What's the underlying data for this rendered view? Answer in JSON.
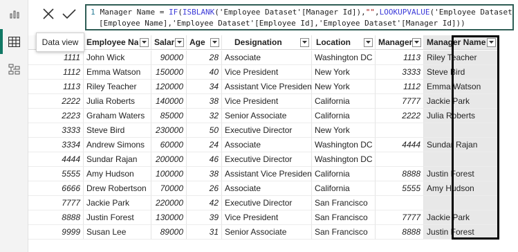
{
  "rail": {
    "icons": [
      "report-view-icon",
      "data-view-icon",
      "model-view-icon"
    ],
    "tooltip": "Data view",
    "accent": "#117865"
  },
  "formula": {
    "line_number": "1",
    "parts": {
      "p1": "Manager Name = ",
      "p2": "IF",
      "p3": "(",
      "p4": "ISBLANK",
      "p5": "('Employee Dataset'[Manager Id]),",
      "p6": "\"\"",
      "p7": ",",
      "p8": "LOOKUPVALUE",
      "p9": "('Employee Dataset'",
      "p10": "[Employee Name],'Employee Dataset'[Employee Id],'Employee Dataset'[Manager Id]))"
    }
  },
  "table": {
    "headers": [
      "",
      "Employee Na",
      "Salar",
      "Age",
      "Designation",
      "Location",
      "Manager",
      "Manager Name"
    ],
    "rows": [
      [
        "1111",
        "John Wick",
        "90000",
        "28",
        "Associate",
        "Washington DC",
        "1113",
        "Riley Teacher"
      ],
      [
        "1112",
        "Emma Watson",
        "150000",
        "40",
        "Vice President",
        "New York",
        "3333",
        "Steve Bird"
      ],
      [
        "1113",
        "Riley Teacher",
        "120000",
        "34",
        "Assistant Vice President",
        "New York",
        "1112",
        "Emma Watson"
      ],
      [
        "2222",
        "Julia Roberts",
        "140000",
        "38",
        "Vice President",
        "California",
        "7777",
        "Jackie Park"
      ],
      [
        "2223",
        "Graham Waters",
        "85000",
        "32",
        "Senior Associate",
        "California",
        "2222",
        "Julia Roberts"
      ],
      [
        "3333",
        "Steve Bird",
        "230000",
        "50",
        "Executive Director",
        "New York",
        "",
        ""
      ],
      [
        "3334",
        "Andrew Simons",
        "60000",
        "24",
        "Associate",
        "Washington DC",
        "4444",
        "Sundar Rajan"
      ],
      [
        "4444",
        "Sundar Rajan",
        "200000",
        "46",
        "Executive Director",
        "Washington DC",
        "",
        ""
      ],
      [
        "5555",
        "Amy Hudson",
        "100000",
        "38",
        "Assistant Vice President",
        "California",
        "8888",
        "Justin Forest"
      ],
      [
        "6666",
        "Drew Robertson",
        "70000",
        "26",
        "Associate",
        "California",
        "5555",
        "Amy Hudson"
      ],
      [
        "7777",
        "Jackie Park",
        "220000",
        "42",
        "Executive Director",
        "San Francisco",
        "",
        ""
      ],
      [
        "8888",
        "Justin Forest",
        "130000",
        "39",
        "Vice President",
        "San Francisco",
        "7777",
        "Jackie Park"
      ],
      [
        "9999",
        "Susan Lee",
        "89000",
        "31",
        "Senior Associate",
        "San Francisco",
        "8888",
        "Justin Forest"
      ]
    ]
  }
}
